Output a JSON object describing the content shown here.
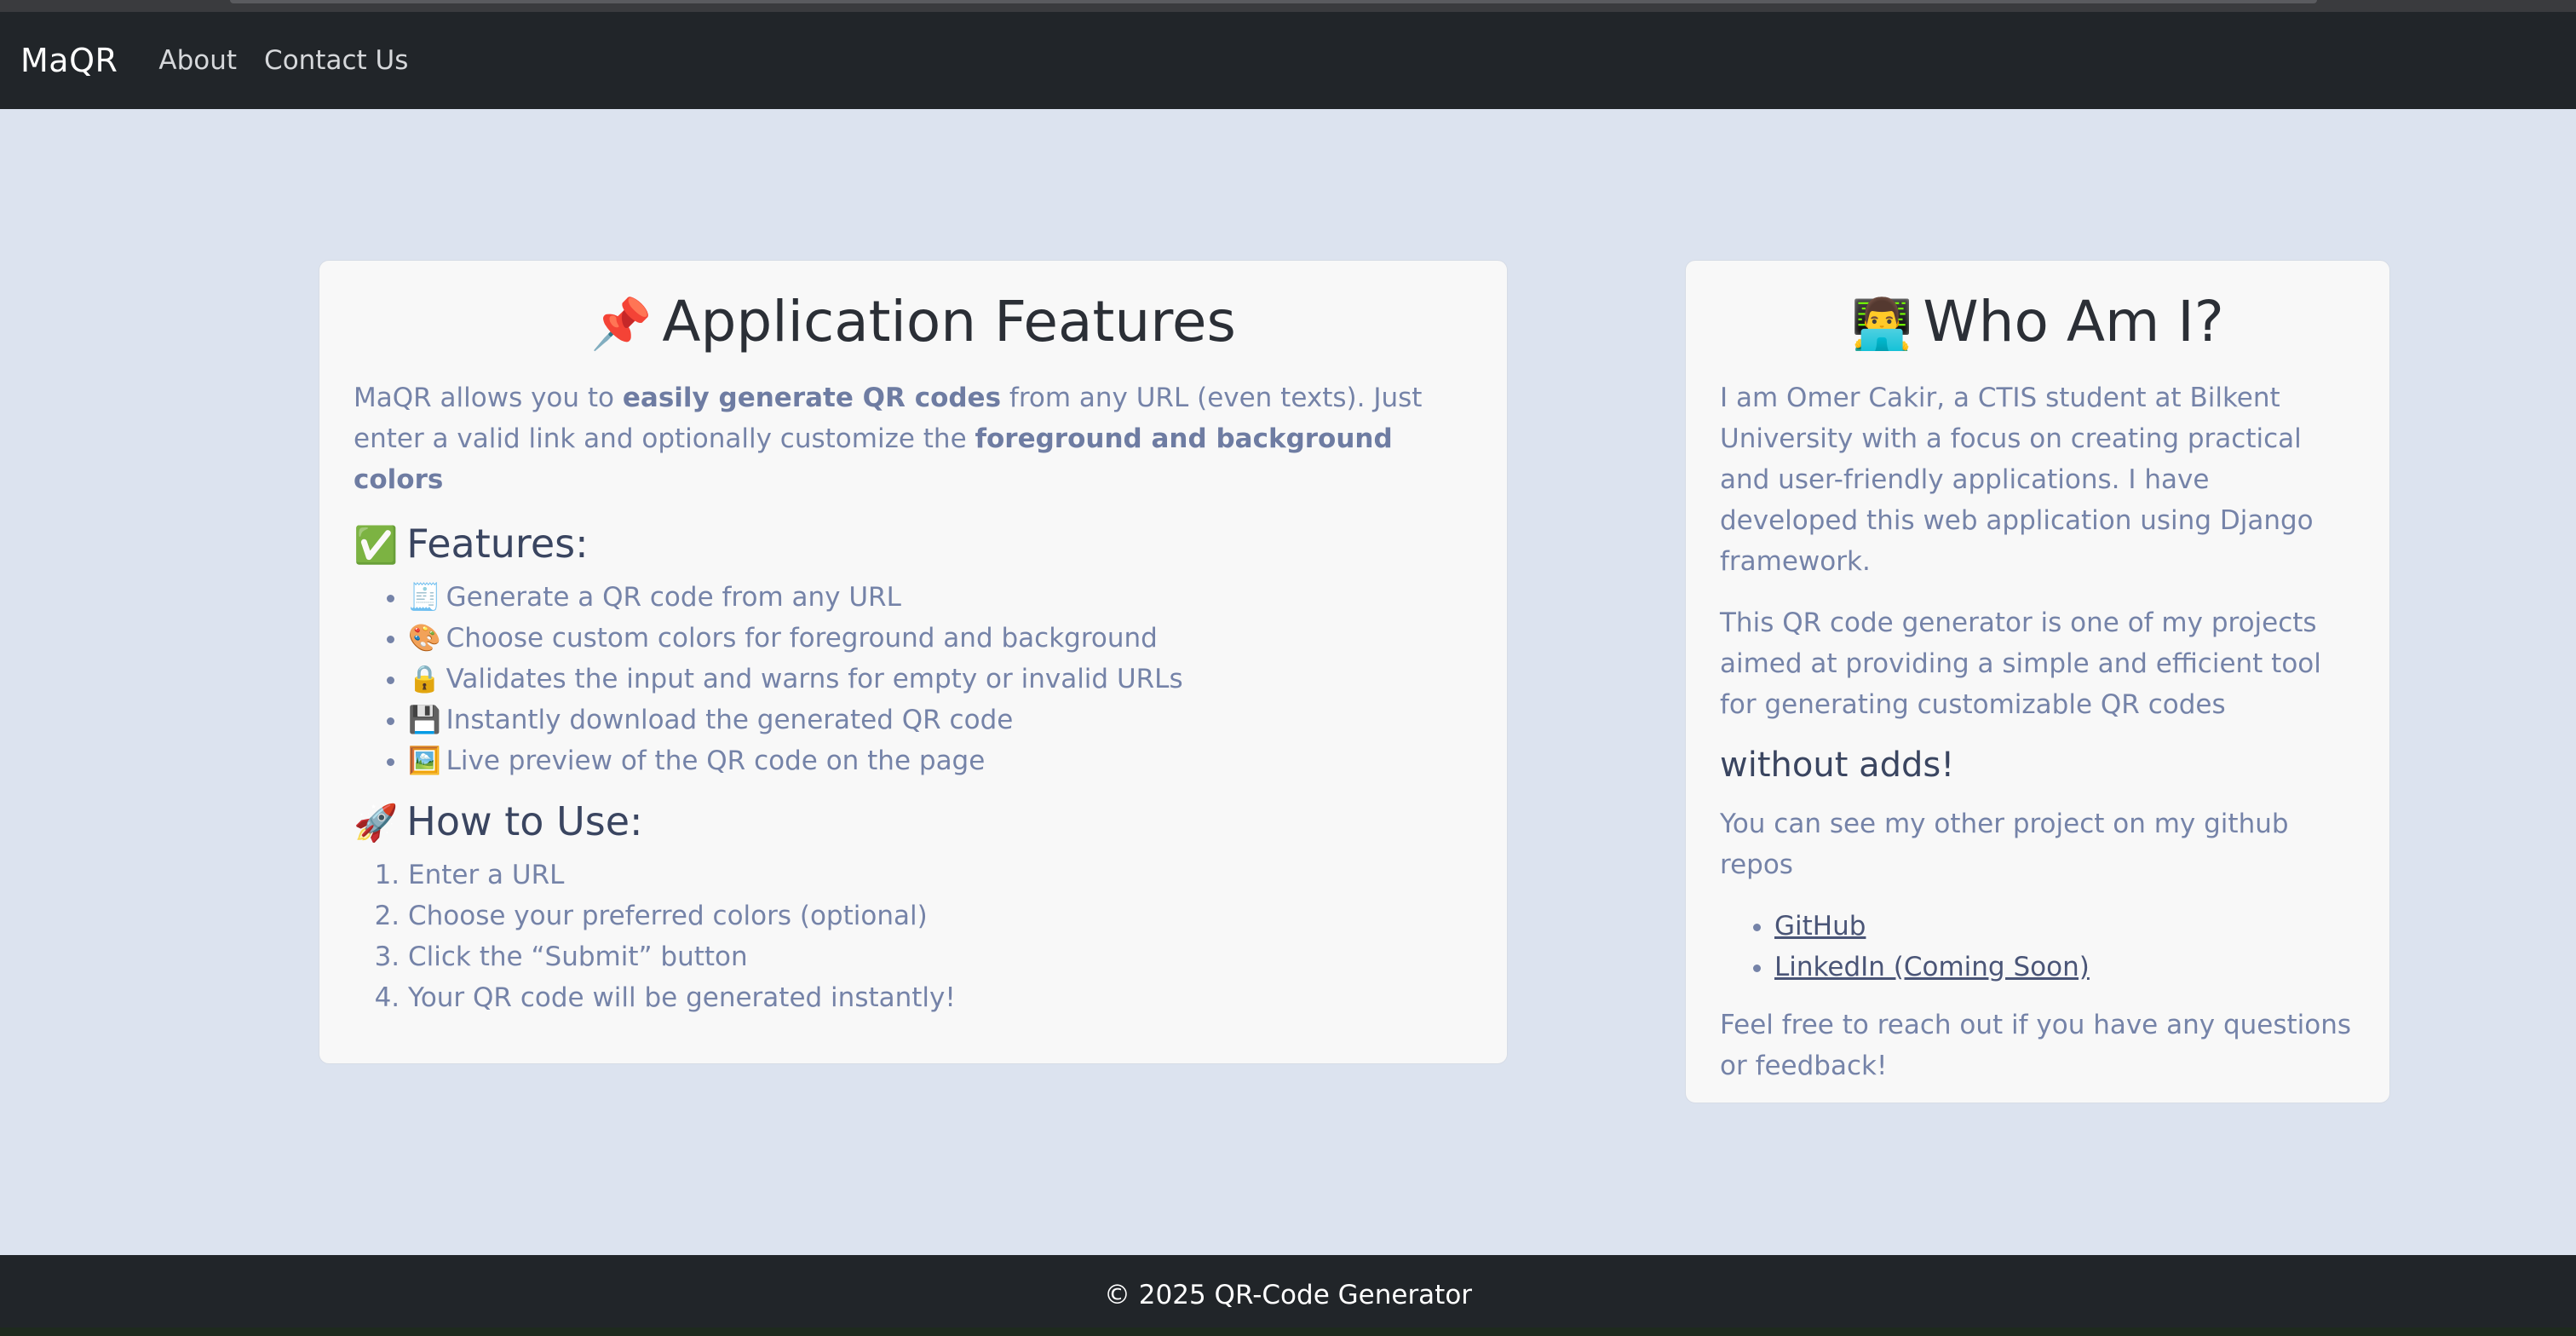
{
  "navbar": {
    "brand": "MaQR",
    "links": [
      "About",
      "Contact Us"
    ]
  },
  "features_card": {
    "title_emoji": "📌",
    "title": "Application Features",
    "intro": {
      "part1": "MaQR allows you to ",
      "bold1": "easily generate QR codes",
      "part2": " from any URL (even texts). Just enter a valid link and optionally customize the ",
      "bold2": "foreground and background colors"
    },
    "features_heading_emoji": "✅",
    "features_heading": "Features:",
    "features": [
      {
        "emoji": "🧾",
        "text": "Generate a QR code from any URL"
      },
      {
        "emoji": "🎨",
        "text": "Choose custom colors for foreground and background"
      },
      {
        "emoji": "🔒",
        "text": "Validates the input and warns for empty or invalid URLs"
      },
      {
        "emoji": "💾",
        "text": "Instantly download the generated QR code"
      },
      {
        "emoji": "🖼️",
        "text": "Live preview of the QR code on the page"
      }
    ],
    "howto_heading_emoji": "🚀",
    "howto_heading": "How to Use:",
    "steps": [
      "Enter a URL",
      "Choose your preferred colors (optional)",
      "Click the “Submit” button",
      "Your QR code will be generated instantly!"
    ]
  },
  "about_card": {
    "title_emoji": "👨‍💻",
    "title": "Who Am I?",
    "para1": "I am Omer Cakir, a CTIS student at Bilkent University with a focus on creating practical and user-friendly applications. I have developed this web application using Django framework.",
    "para2": "This QR code generator is one of my projects aimed at providing a simple and efficient tool for generating customizable QR codes",
    "subheading": "without adds!",
    "para3": "You can see my other project on my github repos",
    "links": [
      "GitHub",
      "LinkedIn (Coming Soon)"
    ],
    "para4": "Feel free to reach out if you have any questions or feedback!"
  },
  "footer": {
    "text": "© 2025 QR-Code Generator"
  }
}
